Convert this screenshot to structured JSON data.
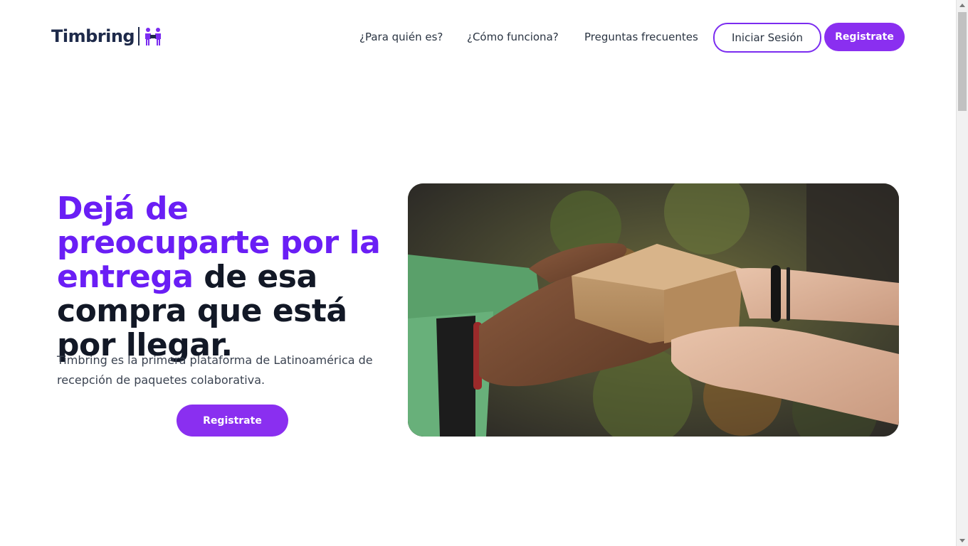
{
  "brand": {
    "name": "Timbring",
    "accent_color": "#8a2ff0",
    "headline_accent_color": "#6a1ef5",
    "text_color": "#121826"
  },
  "nav": {
    "links": [
      {
        "label": "¿Para quién es?"
      },
      {
        "label": "¿Cómo funciona?"
      },
      {
        "label": "Preguntas frecuentes"
      }
    ],
    "login_label": "Iniciar Sesión",
    "register_label": "Registrate"
  },
  "hero": {
    "title_accent": "Dejá de preocuparte por la entrega",
    "title_rest": " de esa compra que está por llegar.",
    "description": "Timbring es la primera plataforma de Latinoamérica de recepción de paquetes colaborativa.",
    "cta_label": "Registrate",
    "image_icon": "package-handoff-photo"
  },
  "scrollbar": {
    "position_fraction": 0.0
  }
}
